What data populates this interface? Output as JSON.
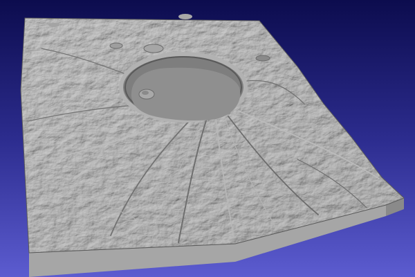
{
  "scene": {
    "subject": "3d-terrain-model",
    "colors": {
      "background_top": "#0c0c4e",
      "background_bottom": "#5c5cd0",
      "terrain_light": "#b4b4b4",
      "terrain_mid": "#8c8c8c",
      "terrain_dark": "#4a4a4a",
      "lake": "#8f8f8f",
      "slab_front": "#a6a6a6",
      "slab_side": "#8a8a8a"
    },
    "features": [
      "terrain-surface",
      "crater-rim",
      "crater-lake",
      "lake-island",
      "radial-ridges",
      "base-slab"
    ]
  }
}
